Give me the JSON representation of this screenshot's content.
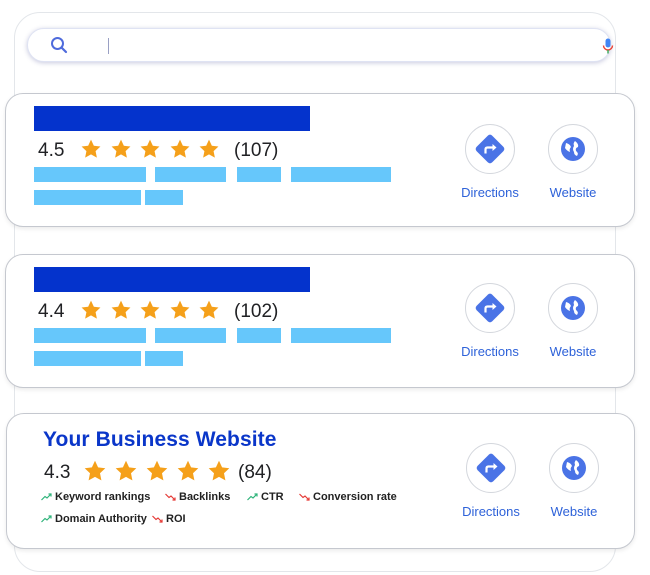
{
  "search": {
    "value": "",
    "placeholder": ""
  },
  "listings": [
    {
      "rating": "4.5",
      "stars": 5,
      "reviews": "(107)"
    },
    {
      "rating": "4.4",
      "stars": 5,
      "reviews": "(102)"
    }
  ],
  "business": {
    "title": "Your Business Website",
    "rating": "4.3",
    "stars": 5,
    "reviews": "(84)",
    "metrics": [
      {
        "label": "Keyword rankings",
        "trend": "up"
      },
      {
        "label": "Backlinks",
        "trend": "down"
      },
      {
        "label": "CTR",
        "trend": "up"
      },
      {
        "label": "Conversion rate",
        "trend": "down"
      },
      {
        "label": "Domain Authority",
        "trend": "up"
      },
      {
        "label": "ROI",
        "trend": "down"
      }
    ]
  },
  "actions": {
    "directions": "Directions",
    "website": "Website"
  },
  "icons": {
    "search": "magnifier-icon",
    "mic": "microphone-icon",
    "star": "star-icon",
    "directions": "directions-diamond-icon",
    "website": "globe-icon",
    "trend_up": "trend-up-arrow-icon",
    "trend_down": "trend-down-arrow-icon"
  },
  "colors": {
    "brand_blue": "#0433cc",
    "placeholder_bar": "#66c7fb",
    "star": "#f5a01a",
    "link_blue": "#2e62d9",
    "up_green": "#2db37a",
    "down_red": "#e53935"
  }
}
